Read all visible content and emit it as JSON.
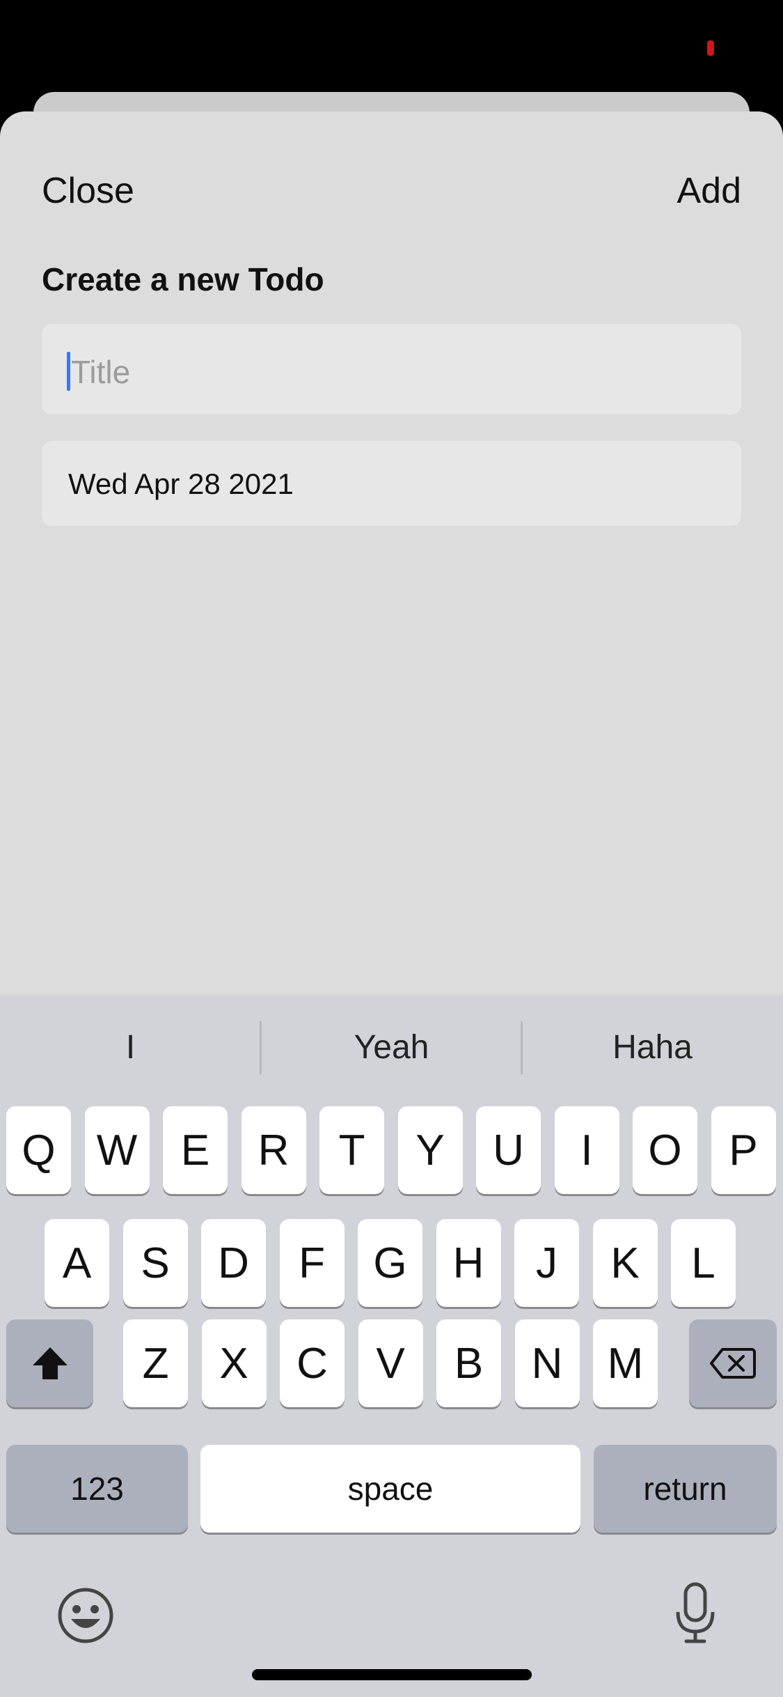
{
  "sheet": {
    "close_label": "Close",
    "add_label": "Add",
    "heading": "Create a new Todo",
    "title_placeholder": "Title",
    "date_value": "Wed Apr 28 2021"
  },
  "keyboard": {
    "suggestions": [
      "I",
      "Yeah",
      "Haha"
    ],
    "row1": [
      "Q",
      "W",
      "E",
      "R",
      "T",
      "Y",
      "U",
      "I",
      "O",
      "P"
    ],
    "row2": [
      "A",
      "S",
      "D",
      "F",
      "G",
      "H",
      "J",
      "K",
      "L"
    ],
    "row3": [
      "Z",
      "X",
      "C",
      "V",
      "B",
      "N",
      "M"
    ],
    "numbers_label": "123",
    "space_label": "space",
    "return_label": "return",
    "icons": {
      "shift": "shift-icon",
      "backspace": "backspace-icon",
      "emoji": "emoji-icon",
      "mic": "microphone-icon"
    }
  },
  "colors": {
    "caret": "#3478f6",
    "sheet_bg": "#dcdcdc",
    "keyboard_bg": "#d1d3d9",
    "recording_indicator": "#d0161b"
  }
}
